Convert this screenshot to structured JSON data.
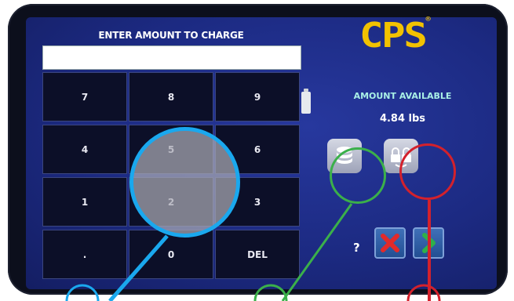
{
  "keypad": {
    "title": "ENTER AMOUNT TO CHARGE",
    "input_value": "",
    "keys": [
      "7",
      "8",
      "9",
      "4",
      "5",
      "6",
      "1",
      "2",
      "3",
      ".",
      "0",
      "DEL"
    ]
  },
  "brand": {
    "logo_text": "CPS",
    "registered_mark": "®"
  },
  "amount_available": {
    "label": "AMOUNT AVAILABLE",
    "value": "4.84 lbs"
  },
  "icons": {
    "tank": "tank-icon",
    "database": "database-icon",
    "lock": "lock-icon",
    "cancel": "x-icon",
    "next": "chevron-right-icon"
  },
  "help_label": "?",
  "colors": {
    "screen": "#1c2a82",
    "logo": "#f2c200",
    "available_label": "#a9f0e6",
    "callout_blue": "#1aa8ee",
    "callout_green": "#3bb04a",
    "callout_red": "#d3212c"
  }
}
